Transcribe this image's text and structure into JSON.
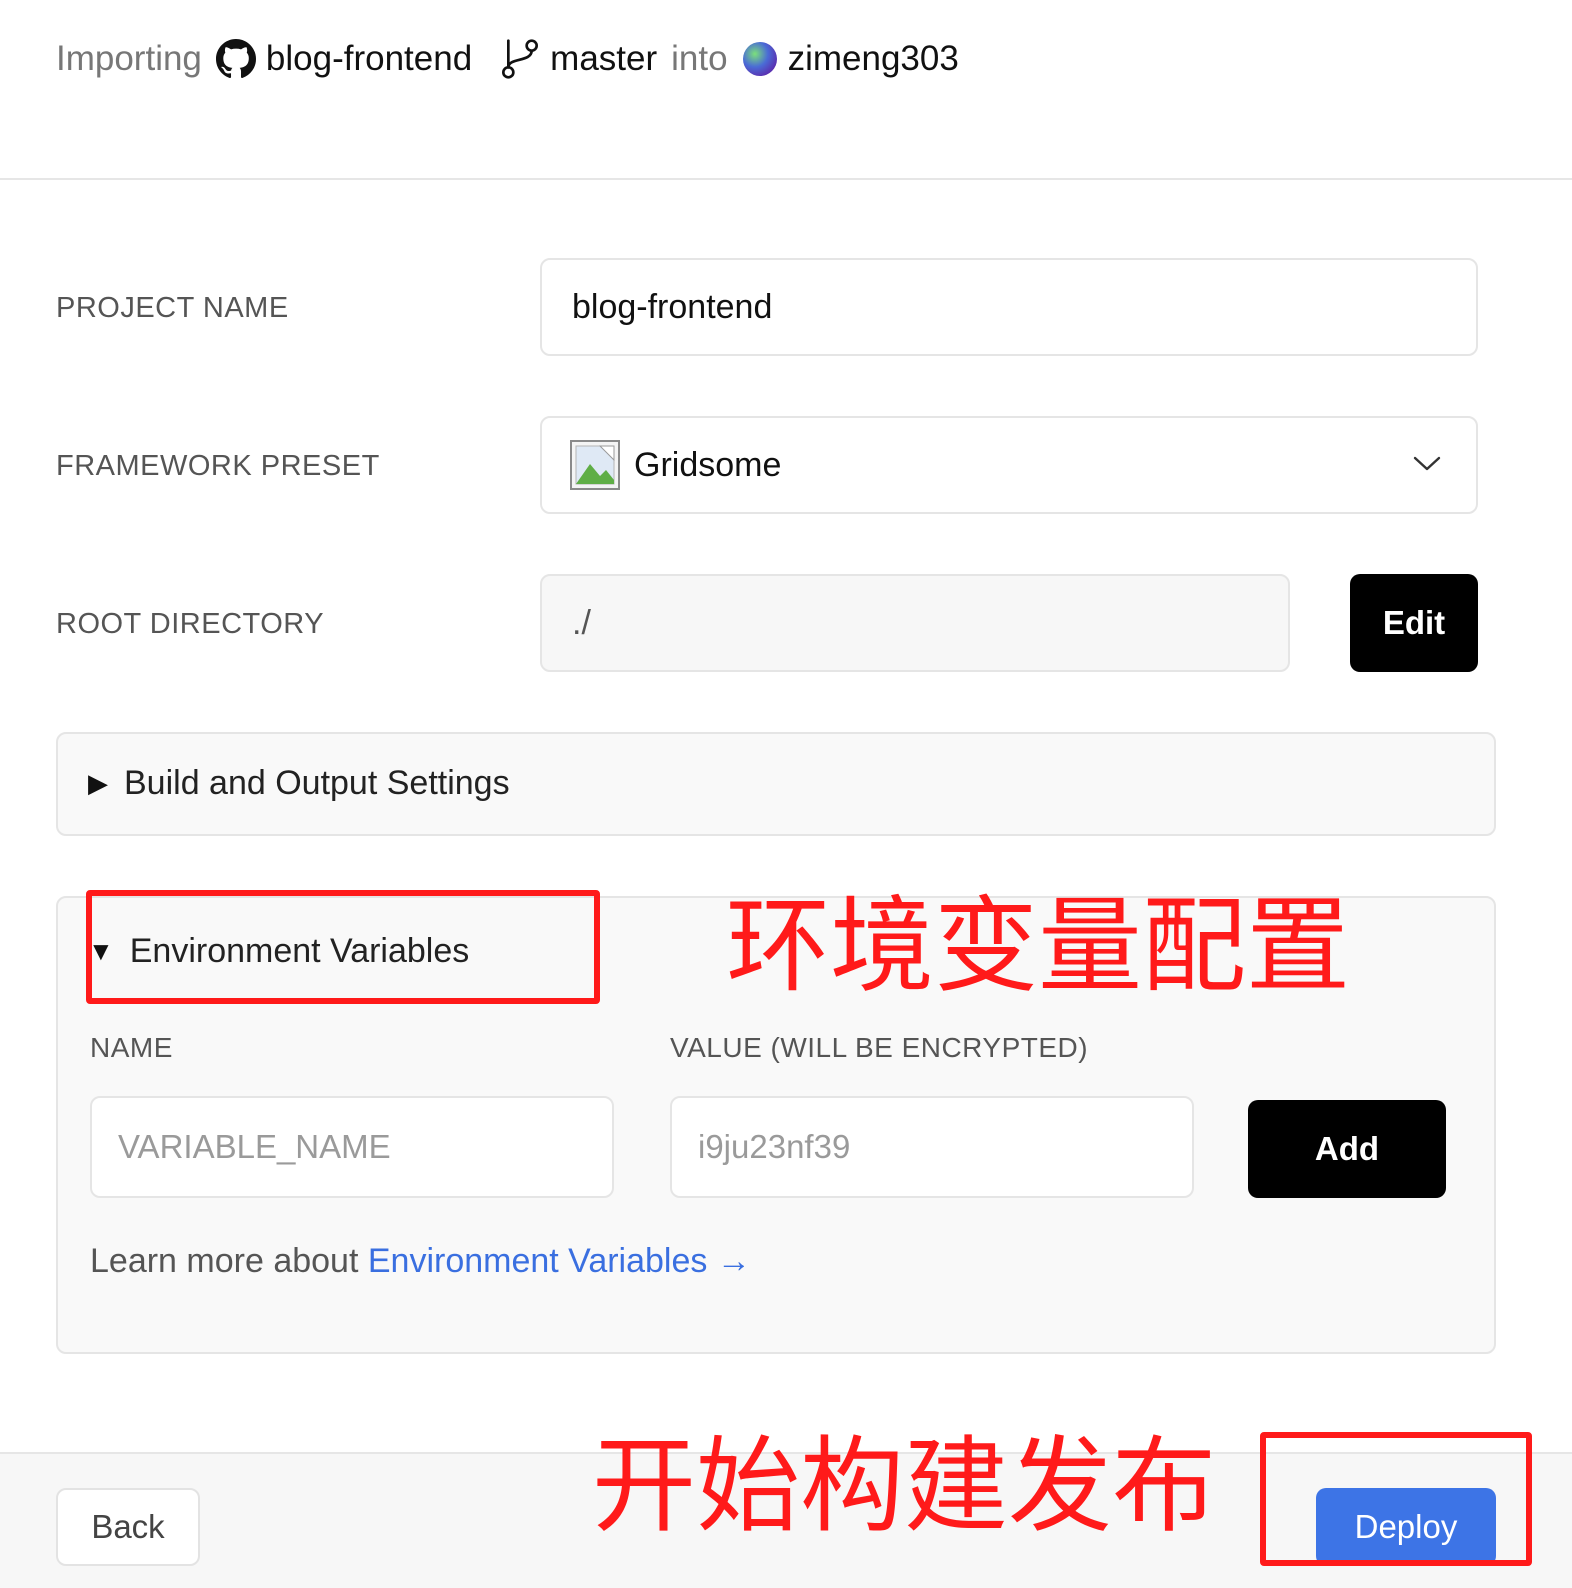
{
  "header": {
    "importing_label": "Importing",
    "repo_name": "blog-frontend",
    "branch_name": "master",
    "into_label": "into",
    "account_name": "zimeng303"
  },
  "form": {
    "project_name": {
      "label": "PROJECT NAME",
      "value": "blog-frontend"
    },
    "framework_preset": {
      "label": "FRAMEWORK PRESET",
      "value": "Gridsome"
    },
    "root_directory": {
      "label": "ROOT DIRECTORY",
      "value": "./",
      "edit_label": "Edit"
    }
  },
  "build_settings": {
    "title": "Build and Output Settings"
  },
  "env": {
    "title": "Environment Variables",
    "name_label": "NAME",
    "value_label": "VALUE (WILL BE ENCRYPTED)",
    "name_placeholder": "VARIABLE_NAME",
    "value_placeholder": "i9ju23nf39",
    "add_label": "Add",
    "learn_prefix": "Learn more about",
    "learn_link": "Environment Variables →"
  },
  "footer": {
    "back_label": "Back",
    "deploy_label": "Deploy"
  },
  "annotations": {
    "env_config": "环境变量配置",
    "start_deploy": "开始构建发布",
    "color": "#ff1a1a"
  },
  "colors": {
    "accent_blue": "#3d74e6",
    "link_blue": "#3a6fe0",
    "primary_black": "#000000"
  },
  "icons": [
    "github-icon",
    "git-branch-icon",
    "avatar-gradient",
    "framework-image-icon",
    "chevron-down-icon",
    "triangle-right-icon",
    "triangle-down-icon"
  ]
}
